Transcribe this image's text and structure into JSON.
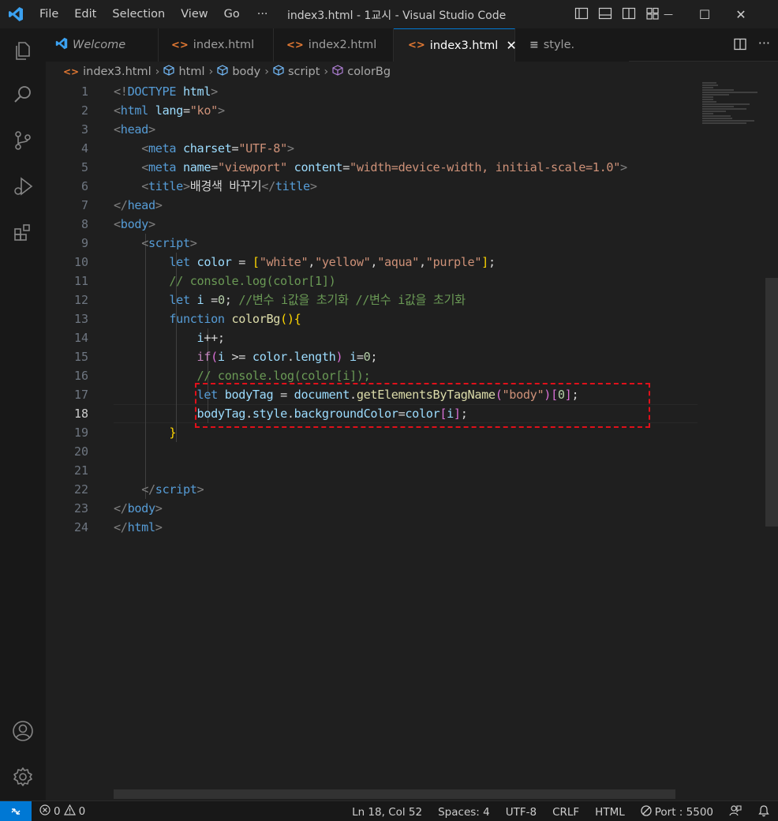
{
  "window": {
    "title": "index3.html - 1교시 - Visual Studio Code",
    "menu": [
      "File",
      "Edit",
      "Selection",
      "View",
      "Go"
    ],
    "more": "···",
    "controls": {
      "minimize": "—",
      "maximize": "☐",
      "close": "✕"
    }
  },
  "tabs": [
    {
      "label": "Welcome",
      "icon": "vscode-logo-icon",
      "italic": true
    },
    {
      "label": "index.html",
      "icon": "html-icon"
    },
    {
      "label": "index2.html",
      "icon": "html-icon"
    },
    {
      "label": "index3.html",
      "icon": "html-icon",
      "active": true,
      "close": "✕"
    },
    {
      "label": "style.",
      "icon": "css-icon"
    }
  ],
  "breadcrumb": [
    "index3.html",
    "html",
    "body",
    "script",
    "colorBg"
  ],
  "editor": {
    "current_line": 18,
    "line_numbers": [
      "1",
      "2",
      "3",
      "4",
      "5",
      "6",
      "7",
      "8",
      "9",
      "10",
      "11",
      "12",
      "13",
      "14",
      "15",
      "16",
      "17",
      "18",
      "19",
      "20",
      "21",
      "22",
      "23",
      "24"
    ],
    "code": {
      "l1": {
        "a": "<!",
        "b": "DOCTYPE",
        "c": " html",
        "d": ">"
      },
      "l2": {
        "a": "<",
        "b": "html",
        "c": " lang",
        "d": "=",
        "e": "\"ko\"",
        "f": ">"
      },
      "l3": {
        "a": "<",
        "b": "head",
        "c": ">"
      },
      "l4": {
        "a": "<",
        "b": "meta",
        "c": " charset",
        "d": "=",
        "e": "\"UTF-8\"",
        "f": ">"
      },
      "l5": {
        "a": "<",
        "b": "meta",
        "c": " name",
        "d": "=",
        "e": "\"viewport\"",
        "f": " content",
        "g": "=",
        "h": "\"width=device-width, initial-scale=1.0\"",
        "i": ">"
      },
      "l6": {
        "a": "<",
        "b": "title",
        "c": ">",
        "d": "배경색 바꾸기",
        "e": "</",
        "f": "title",
        "g": ">"
      },
      "l7": {
        "a": "</",
        "b": "head",
        "c": ">"
      },
      "l8": {
        "a": "<",
        "b": "body",
        "c": ">"
      },
      "l9": {
        "a": "<",
        "b": "script",
        "c": ">"
      },
      "l10": {
        "a": "let",
        "b": " color",
        "c": " = ",
        "d": "[",
        "e": "\"white\"",
        "f": ",",
        "g": "\"yellow\"",
        "h": ",",
        "i": "\"aqua\"",
        "j": ",",
        "k": "\"purple\"",
        "l": "]",
        "m": ";"
      },
      "l11": {
        "a": "// console.log(color[1])"
      },
      "l12": {
        "a": "let",
        "b": " i",
        "c": " =",
        "d": "0",
        "e": "; ",
        "f": "//변수 i값을 초기화 //변수 i값을 초기화"
      },
      "l13": {
        "a": "function",
        "b": " colorBg",
        "c": "()",
        "d": "{"
      },
      "l14": {
        "a": "i",
        "b": "++;"
      },
      "l15": {
        "a": "if",
        "b": "(",
        "c": "i",
        "d": " >= ",
        "e": "color",
        "f": ".",
        "g": "length",
        "h": ")",
        "i": " i",
        "j": "=",
        "k": "0",
        "l": ";"
      },
      "l16": {
        "a": "// console.log(color[i]);"
      },
      "l17": {
        "a": "let",
        "b": " bodyTag",
        "c": " = ",
        "d": "document",
        "e": ".",
        "f": "getElementsByTagName",
        "g": "(",
        "h": "\"body\"",
        "i": ")",
        "j": "[",
        "k": "0",
        "l": "]",
        "m": ";"
      },
      "l18": {
        "a": "bodyTag",
        "b": ".",
        "c": "style",
        "d": ".",
        "e": "backgroundColor",
        "f": "=",
        "g": "color",
        "h": "[",
        "i": "i",
        "j": "]",
        "k": ";"
      },
      "l19": {
        "a": "}"
      },
      "l22": {
        "a": "</",
        "b": "script",
        "c": ">"
      },
      "l23": {
        "a": "</",
        "b": "body",
        "c": ">"
      },
      "l24": {
        "a": "</",
        "b": "html",
        "c": ">"
      }
    }
  },
  "status": {
    "errors": "0",
    "warnings": "0",
    "position": "Ln 18, Col 52",
    "spaces": "Spaces: 4",
    "encoding": "UTF-8",
    "eol": "CRLF",
    "language": "HTML",
    "port": "Port : 5500"
  },
  "colors": {
    "accent": "#0078d4",
    "highlight_box": "#e0101a",
    "editor_bg": "#1f1f1f"
  }
}
